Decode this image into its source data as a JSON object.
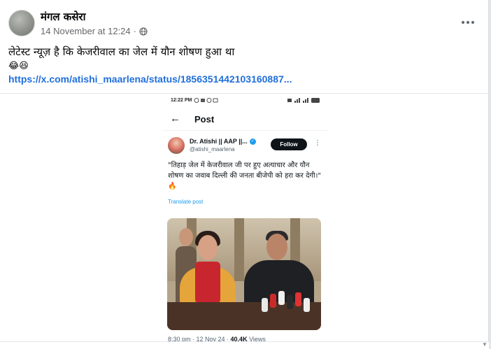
{
  "post": {
    "author": "मंगल कसेरा",
    "date": "14 November at 12:24",
    "separator": "·",
    "privacy_icon": "globe-icon",
    "text": "लेटेस्ट न्यूज़ है कि केजरीवाल का जेल में यौन शोषण हुआ था",
    "emojis": "😂😆",
    "link": "https://x.com/atishi_maarlena/status/1856351442103160887..."
  },
  "screenshot": {
    "status_time": "12:22 PM",
    "header_title": "Post",
    "tweet": {
      "display_name": "Dr. Atishi || AAP ||...",
      "verified": true,
      "handle": "@atishi_maarlena",
      "follow_label": "Follow",
      "text": "\"तिहाड़ जेल में केजरीवाल जी पर हुए अत्याचार और यौन शोषण का जवाब दिल्ली की जनता बीजेपी को हरा कर देगी।\" 🔥",
      "translate_label": "Translate post",
      "footer_time": "8:30 pm · 12 Nov 24 · ",
      "footer_views_count": "40.4K",
      "footer_views_label": " Views"
    }
  },
  "colors": {
    "link": "#216fdb",
    "text": "#050505",
    "secondary": "#65676b",
    "follow_bg": "#0f1419",
    "twitter_blue": "#1d9bf0"
  }
}
